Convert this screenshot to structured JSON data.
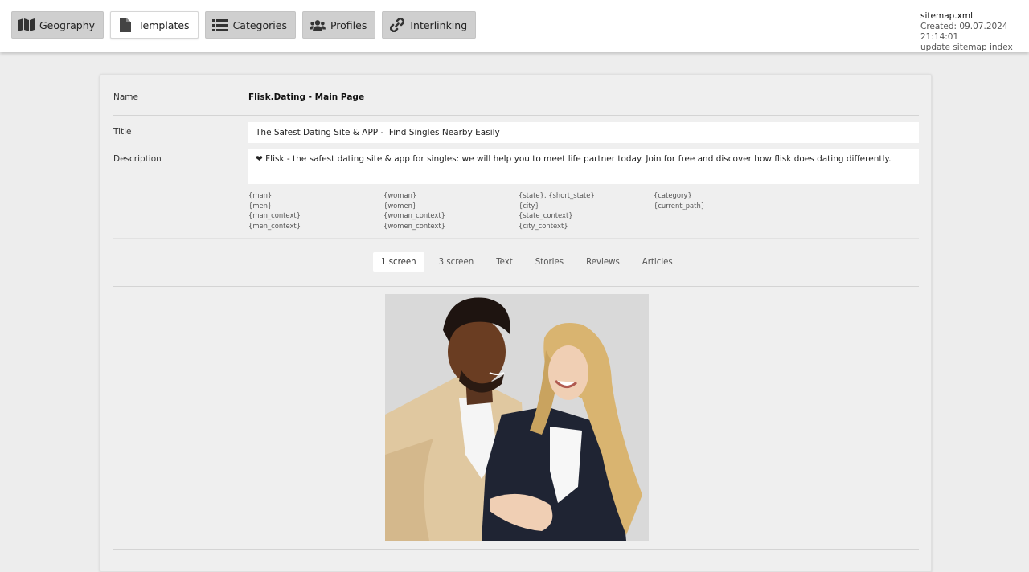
{
  "nav": {
    "items": [
      {
        "label": "Geography",
        "icon": "map-icon",
        "active": false
      },
      {
        "label": "Templates",
        "icon": "file-icon",
        "active": true
      },
      {
        "label": "Categories",
        "icon": "list-icon",
        "active": false
      },
      {
        "label": "Profiles",
        "icon": "users-icon",
        "active": false
      },
      {
        "label": "Interlinking",
        "icon": "link-icon",
        "active": false
      }
    ]
  },
  "sitemap": {
    "file": "sitemap.xml",
    "created": "Created: 09.07.2024 21:14:01",
    "update": "update sitemap index"
  },
  "template": {
    "name_label": "Name",
    "name_value": "Flisk.Dating - Main Page",
    "title_label": "Title",
    "title_value": "The Safest Dating Site & APP -  Find Singles Nearby Easily",
    "description_label": "Description",
    "description_value": "❤ Flisk - the safest dating site & app for singles: we will help you to meet life partner today. Join for free and discover how flisk does dating differently."
  },
  "variables": {
    "col1": [
      "{man}",
      "{men}",
      "{man_context}",
      "{men_context}"
    ],
    "col2": [
      "{woman}",
      "{women}",
      "{woman_context}",
      "{women_context}"
    ],
    "col3": [
      "{state}, {short_state}",
      "{city}",
      "{state_context}",
      "{city_context}"
    ],
    "col4": [
      "{category}",
      "{current_path}"
    ]
  },
  "tabs": [
    {
      "label": "1 screen",
      "active": true
    },
    {
      "label": "3 screen",
      "active": false
    },
    {
      "label": "Text",
      "active": false
    },
    {
      "label": "Stories",
      "active": false
    },
    {
      "label": "Reviews",
      "active": false
    },
    {
      "label": "Articles",
      "active": false
    }
  ],
  "colors": {
    "page_bg": "#ededed",
    "nav_button_bg": "#cfcfcf",
    "nav_active_bg": "#ffffff",
    "card_bg": "#efefef"
  }
}
